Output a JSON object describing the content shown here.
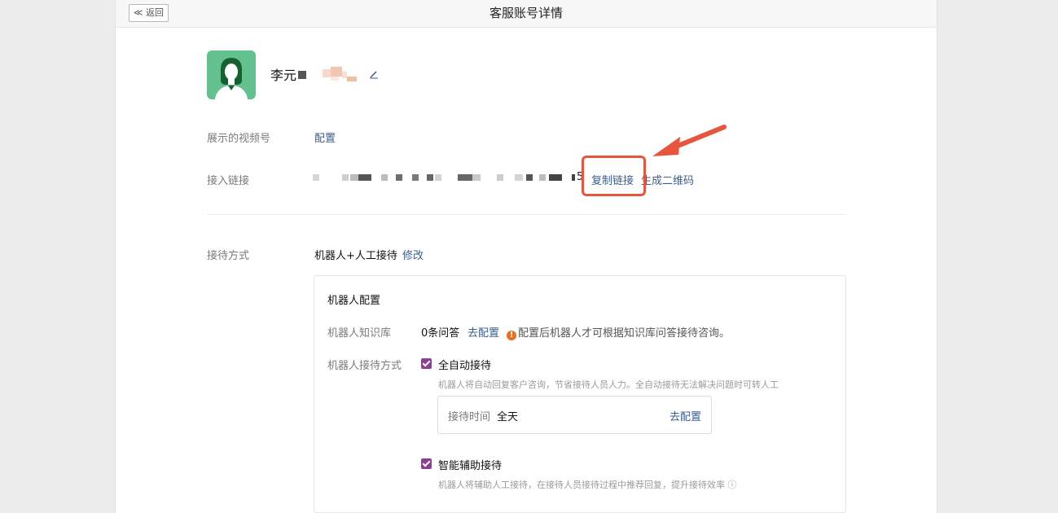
{
  "header": {
    "back_label": "≪ 返回",
    "title": "客服账号详情"
  },
  "profile": {
    "name": "李元"
  },
  "video_account": {
    "label": "展示的视频号",
    "action": "配置"
  },
  "access_link": {
    "label": "接入链接",
    "copy_label": "复制链接",
    "qrcode_label": "生成二维码",
    "url_tail": "5"
  },
  "reception": {
    "label": "接待方式",
    "mode": "机器人+人工接待",
    "modify_label": "修改"
  },
  "robot_config": {
    "title": "机器人配置",
    "kb_label": "机器人知识库",
    "kb_count": "0条问答",
    "kb_action": "去配置",
    "kb_warning": "配置后机器人才可根据知识库问答接待咨询。",
    "mode_label": "机器人接待方式",
    "auto": {
      "label": "全自动接待",
      "checked": true,
      "hint": "机器人将自动回复客户咨询，节省接待人员人力。全自动接待无法解决问题时可转人工"
    },
    "time": {
      "label": "接待时间",
      "value": "全天",
      "action": "去配置"
    },
    "assist": {
      "label": "智能辅助接待",
      "checked": true,
      "hint": "机器人将辅助人工接待，在接待人员接待过程中推荐回复，提升接待效率 ⓘ"
    }
  },
  "colors": {
    "accent_link": "#3a5d91",
    "checkbox": "#8d3f94",
    "highlight": "#e9543f",
    "avatar_bg": "#62c18f",
    "warning": "#f06c1e"
  }
}
